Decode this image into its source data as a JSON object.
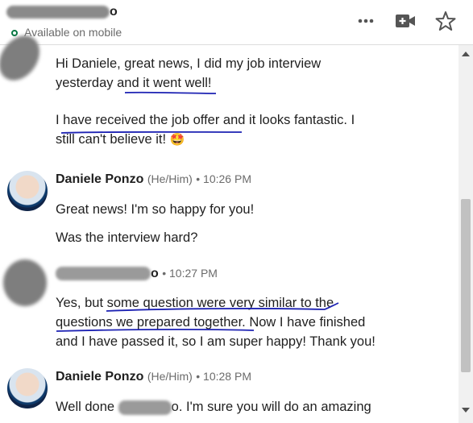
{
  "header": {
    "name_suffix": "o",
    "status": "Available on mobile"
  },
  "messages": {
    "m1_line1": "Hi Daniele, great news, I did my job interview",
    "m1_line2": "yesterday and it went well!",
    "m1_line3": "I have received the job offer and it looks fantastic. I",
    "m1_line4": "still can't believe it!",
    "m1_emoji": "🤩",
    "s2_name": "Daniele Ponzo",
    "s2_pron": "(He/Him)",
    "s2_time": "• 10:26 PM",
    "m2_line1": "Great news! I'm so happy for you!",
    "m2_line2": "Was the interview hard?",
    "s3_suffix": "o",
    "s3_time": "• 10:27 PM",
    "m3_line1": "Yes, but some question were very similar to the",
    "m3_line2": "questions we prepared together. Now I have finished",
    "m3_line3": "and I have passed it, so I am super happy! Thank you!",
    "s4_name": "Daniele Ponzo",
    "s4_pron": "(He/Him)",
    "s4_time": "• 10:28 PM",
    "m4_prefix": "Well done",
    "m4_suffix": "o. I'm sure you will do an amazing"
  },
  "icons": [
    "more-options-icon",
    "video-call-icon",
    "star-icon",
    "online-status-icon",
    "scroll-up-icon",
    "scroll-down-icon"
  ],
  "colors": {
    "status_green": "#057642",
    "ink_blue": "#1d22b3"
  }
}
